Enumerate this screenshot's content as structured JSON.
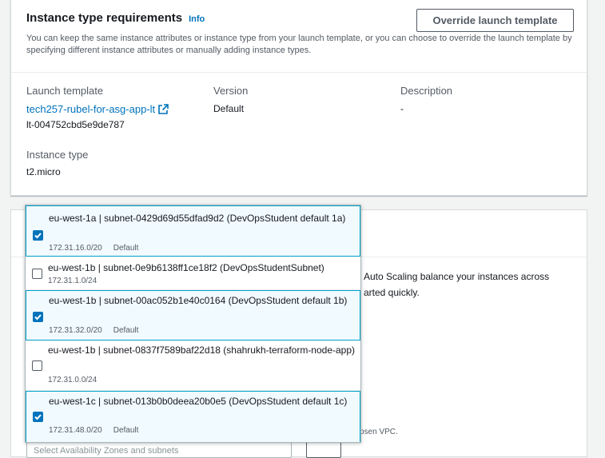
{
  "instance_req": {
    "title": "Instance type requirements",
    "info": "Info",
    "override_button": "Override launch template",
    "description": "You can keep the same instance attributes or instance type from your launch template, or you can choose to override the launch template by specifying different instance attributes or manually adding instance types.",
    "launch_template_label": "Launch template",
    "launch_template_name": "tech257-rubel-for-asg-app-lt",
    "launch_template_id": "lt-004752cbd5e9de787",
    "version_label": "Version",
    "version_value": "Default",
    "description_label": "Description",
    "description_value": "-",
    "instance_type_label": "Instance type",
    "instance_type_value": "t2.micro"
  },
  "network": {
    "body_text": "Auto Scaling balance your instances across",
    "body_text2": "arted quickly.",
    "small_text": "osen VPC.",
    "select_placeholder": "Select Availability Zones and subnets"
  },
  "subnets": [
    {
      "label": "eu-west-1a | subnet-0429d69d55dfad9d2 (DevOpsStudent default 1a)",
      "cidr": "172.31.16.0/20",
      "tag": "Default",
      "checked": true
    },
    {
      "label": "eu-west-1b | subnet-0e9b6138ff1ce18f2 (DevOpsStudentSubnet)",
      "cidr": "172.31.1.0/24",
      "tag": "",
      "checked": false
    },
    {
      "label": "eu-west-1b | subnet-00ac052b1e40c0164 (DevOpsStudent default 1b)",
      "cidr": "172.31.32.0/20",
      "tag": "Default",
      "checked": true
    },
    {
      "label": "eu-west-1b | subnet-0837f7589baf22d18 (shahrukh-terraform-node-app)",
      "cidr": "172.31.0.0/24",
      "tag": "",
      "checked": false
    },
    {
      "label": "eu-west-1c | subnet-013b0b0deea20b0e5 (DevOpsStudent default 1c)",
      "cidr": "172.31.48.0/20",
      "tag": "Default",
      "checked": true
    }
  ],
  "colors": {
    "link": "#0073bb",
    "selected_bg": "#f1faff",
    "selected_border": "#00a1c9"
  }
}
